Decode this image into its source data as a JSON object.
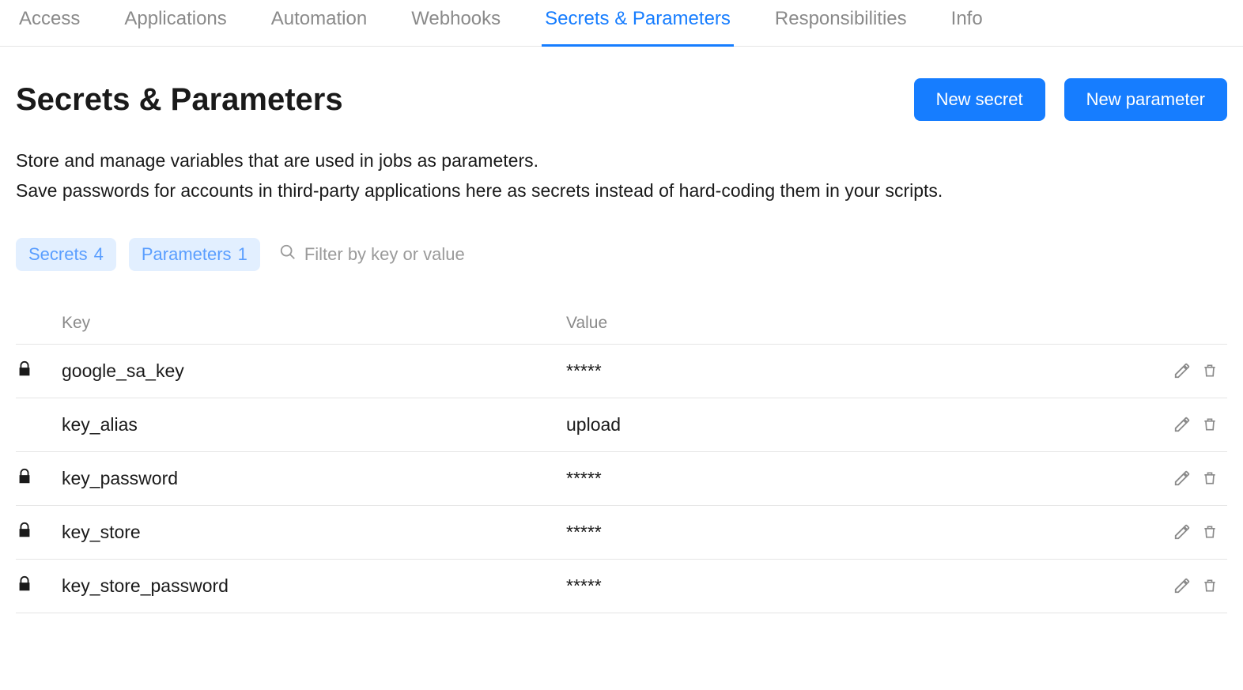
{
  "tabs": [
    {
      "label": "Access",
      "active": false
    },
    {
      "label": "Applications",
      "active": false
    },
    {
      "label": "Automation",
      "active": false
    },
    {
      "label": "Webhooks",
      "active": false
    },
    {
      "label": "Secrets & Parameters",
      "active": true
    },
    {
      "label": "Responsibilities",
      "active": false
    },
    {
      "label": "Info",
      "active": false
    }
  ],
  "page": {
    "title": "Secrets & Parameters",
    "description_line1": "Store and manage variables that are used in jobs as parameters.",
    "description_line2": "Save passwords for accounts in third-party applications here as secrets instead of hard-coding them in your scripts."
  },
  "buttons": {
    "new_secret": "New secret",
    "new_parameter": "New parameter"
  },
  "chips": {
    "secrets_label": "Secrets",
    "secrets_count": "4",
    "parameters_label": "Parameters",
    "parameters_count": "1"
  },
  "filter": {
    "placeholder": "Filter by key or value"
  },
  "table": {
    "header_key": "Key",
    "header_value": "Value",
    "rows": [
      {
        "secret": true,
        "key": "google_sa_key",
        "value": "*****"
      },
      {
        "secret": false,
        "key": "key_alias",
        "value": "upload"
      },
      {
        "secret": true,
        "key": "key_password",
        "value": "*****"
      },
      {
        "secret": true,
        "key": "key_store",
        "value": "*****"
      },
      {
        "secret": true,
        "key": "key_store_password",
        "value": "*****"
      }
    ]
  }
}
